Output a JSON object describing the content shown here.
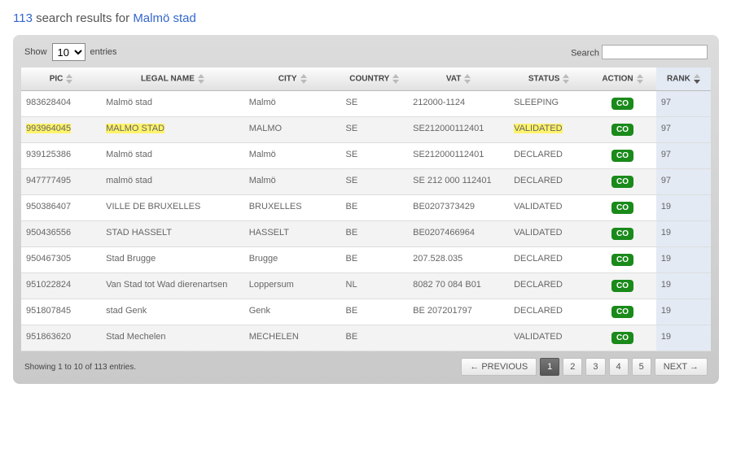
{
  "header": {
    "count": "113",
    "text": "search results for",
    "term": "Malmö stad"
  },
  "controls": {
    "show_label": "Show",
    "entries_label": "entries",
    "length_value": "10",
    "search_label": "Search"
  },
  "columns": {
    "pic": "PIC",
    "name": "LEGAL NAME",
    "city": "CITY",
    "country": "COUNTRY",
    "vat": "VAT",
    "status": "STATUS",
    "action": "ACTION",
    "rank": "RANK"
  },
  "rows": [
    {
      "pic": "983628404",
      "name": "Malmö stad",
      "city": "Malmö",
      "country": "SE",
      "vat": "212000-1124",
      "status": "SLEEPING",
      "action": "CO",
      "rank": "97",
      "highlight": false
    },
    {
      "pic": "993964045",
      "name": "MALMO STAD",
      "city": "MALMO",
      "country": "SE",
      "vat": "SE212000112401",
      "status": "VALIDATED",
      "action": "CO",
      "rank": "97",
      "highlight": true
    },
    {
      "pic": "939125386",
      "name": "Malmö stad",
      "city": "Malmö",
      "country": "SE",
      "vat": "SE212000112401",
      "status": "DECLARED",
      "action": "CO",
      "rank": "97",
      "highlight": false
    },
    {
      "pic": "947777495",
      "name": "malmö stad",
      "city": "Malmö",
      "country": "SE",
      "vat": "SE 212 000 112401",
      "status": "DECLARED",
      "action": "CO",
      "rank": "97",
      "highlight": false
    },
    {
      "pic": "950386407",
      "name": "VILLE DE BRUXELLES",
      "city": "BRUXELLES",
      "country": "BE",
      "vat": "BE0207373429",
      "status": "VALIDATED",
      "action": "CO",
      "rank": "19",
      "highlight": false
    },
    {
      "pic": "950436556",
      "name": "STAD HASSELT",
      "city": "HASSELT",
      "country": "BE",
      "vat": "BE0207466964",
      "status": "VALIDATED",
      "action": "CO",
      "rank": "19",
      "highlight": false
    },
    {
      "pic": "950467305",
      "name": "Stad Brugge",
      "city": "Brugge",
      "country": "BE",
      "vat": "207.528.035",
      "status": "DECLARED",
      "action": "CO",
      "rank": "19",
      "highlight": false
    },
    {
      "pic": "951022824",
      "name": "Van Stad tot Wad dierenartsen",
      "city": "Loppersum",
      "country": "NL",
      "vat": "8082 70 084 B01",
      "status": "DECLARED",
      "action": "CO",
      "rank": "19",
      "highlight": false
    },
    {
      "pic": "951807845",
      "name": "stad Genk",
      "city": "Genk",
      "country": "BE",
      "vat": "BE 207201797",
      "status": "DECLARED",
      "action": "CO",
      "rank": "19",
      "highlight": false
    },
    {
      "pic": "951863620",
      "name": "Stad Mechelen",
      "city": "MECHELEN",
      "country": "BE",
      "vat": "",
      "status": "VALIDATED",
      "action": "CO",
      "rank": "19",
      "highlight": false
    }
  ],
  "footer": {
    "info": "Showing 1 to 10 of 113 entries."
  },
  "pager": {
    "prev": "← PREVIOUS",
    "next": "NEXT →",
    "pages": [
      "1",
      "2",
      "3",
      "4",
      "5"
    ],
    "active": "1"
  }
}
